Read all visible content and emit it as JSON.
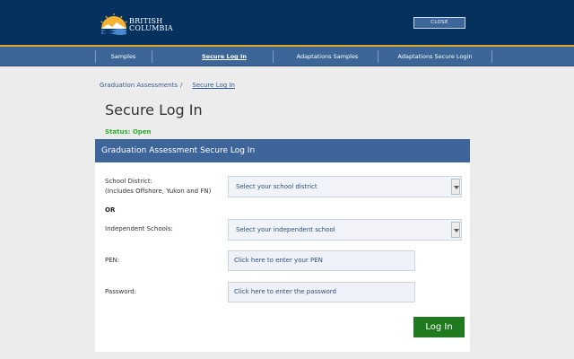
{
  "header": {
    "logo_line1": "BRITISH",
    "logo_line2": "COLUMBIA",
    "close_label": "CLOSE"
  },
  "nav": {
    "items": [
      {
        "label": "Samples"
      },
      {
        "label": "Secure Log In"
      },
      {
        "label": "Adaptations Samples"
      },
      {
        "label": "Adaptations Secure Login"
      }
    ]
  },
  "breadcrumb": {
    "parent": "Graduation Assessments",
    "separator": "/",
    "current": "Secure Log In"
  },
  "page": {
    "title": "Secure Log In",
    "status": "Status: Open"
  },
  "panel": {
    "title": "Graduation Assessment Secure Log In"
  },
  "form": {
    "district_label_line1": "School District:",
    "district_label_line2": "(Includes Offshore, Yukon and FN)",
    "district_select": "Select your school district",
    "or_label": "OR",
    "independent_label": "Independent Schools:",
    "independent_select": "Select your independent school",
    "pen_label": "PEN:",
    "pen_placeholder": "Click here to enter your PEN",
    "password_label": "Password:",
    "password_placeholder": "Click here to enter the password",
    "login_label": "Log In"
  },
  "colors": {
    "header_bg": "#05315e",
    "nav_bg": "#3c6698",
    "accent_gold": "#e3a82b",
    "panel_header_bg": "#3d6599",
    "status_green": "#2ab02a",
    "login_green": "#1f7a1f"
  }
}
